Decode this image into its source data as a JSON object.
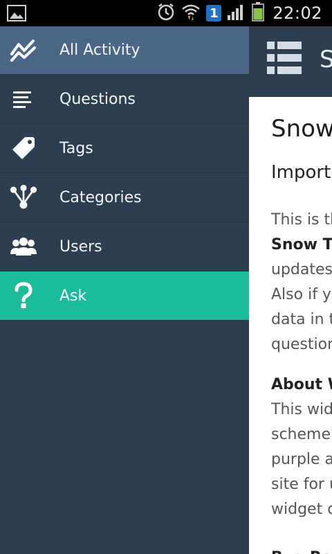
{
  "status_bar": {
    "time": "22:02",
    "sim_number": "1",
    "icons": [
      "picture-icon",
      "alarm-icon",
      "wifi-icon",
      "sim-card-icon",
      "signal-icon",
      "battery-icon"
    ]
  },
  "drawer": {
    "items": [
      {
        "label": "All Activity",
        "icon": "activity-chart-icon"
      },
      {
        "label": "Questions",
        "icon": "text-lines-icon"
      },
      {
        "label": "Tags",
        "icon": "tag-icon"
      },
      {
        "label": "Categories",
        "icon": "categories-tree-icon"
      },
      {
        "label": "Users",
        "icon": "users-icon"
      },
      {
        "label": "Ask",
        "icon": "question-mark-icon"
      }
    ]
  },
  "colors": {
    "drawer_bg": "#2c3e50",
    "selected_item_bg": "#4b6787",
    "ask_item_bg": "#1abc9c"
  },
  "content": {
    "header_title": "S",
    "title": "Snow",
    "heading": "Importa",
    "lines": [
      "This is th",
      "Snow Th",
      "updates",
      "Also if yo",
      "data in t",
      "question"
    ],
    "about_heading": "About W",
    "about_lines": [
      "This wide",
      "scheme.",
      "purple a",
      "site for u",
      "widget c"
    ],
    "bug_heading": "Bug Rep"
  }
}
